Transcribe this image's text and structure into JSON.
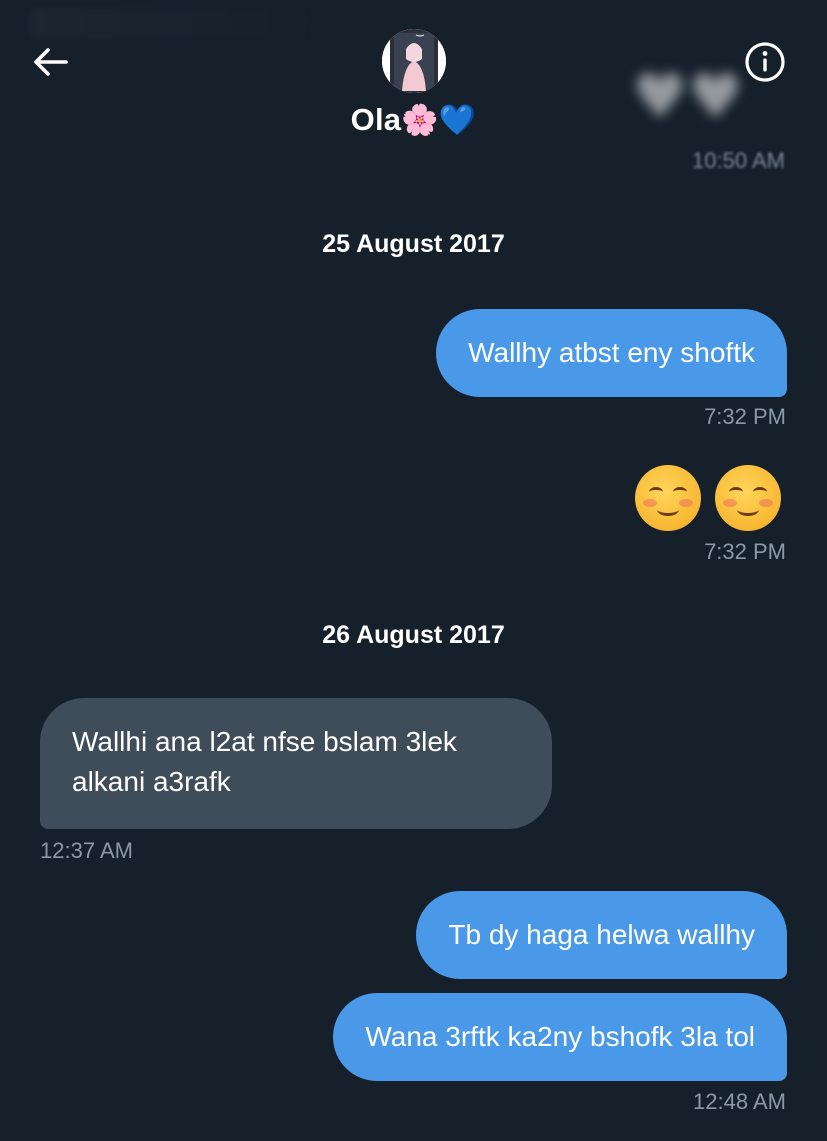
{
  "header": {
    "contact_name": "Ola",
    "name_emojis": "🌸💙",
    "back_icon": "arrow-left-icon",
    "info_icon": "info-circle-icon"
  },
  "partial": {
    "emojis": "♥♥",
    "time": "10:50 AM"
  },
  "conversation": [
    {
      "type": "date",
      "label": "25 August 2017"
    },
    {
      "type": "sent",
      "text": "Wallhy atbst eny shoftk",
      "time": "7:32 PM"
    },
    {
      "type": "sent-emoji",
      "emojis": [
        "smiling-face-icon",
        "smiling-face-icon"
      ],
      "time": "7:32 PM"
    },
    {
      "type": "date",
      "label": "26 August 2017"
    },
    {
      "type": "received",
      "text": "Wallhi ana l2at nfse bslam 3lek alkani a3rafk",
      "time": "12:37 AM"
    },
    {
      "type": "sent",
      "text": "Tb dy haga helwa wallhy"
    },
    {
      "type": "sent",
      "text": "Wana 3rftk ka2ny bshofk 3la tol",
      "time": "12:48 AM"
    }
  ],
  "colors": {
    "background": "#15202b",
    "sent_bubble": "#4a99e9",
    "received_bubble": "#3f4d5b",
    "timestamp": "#8b98a5"
  }
}
